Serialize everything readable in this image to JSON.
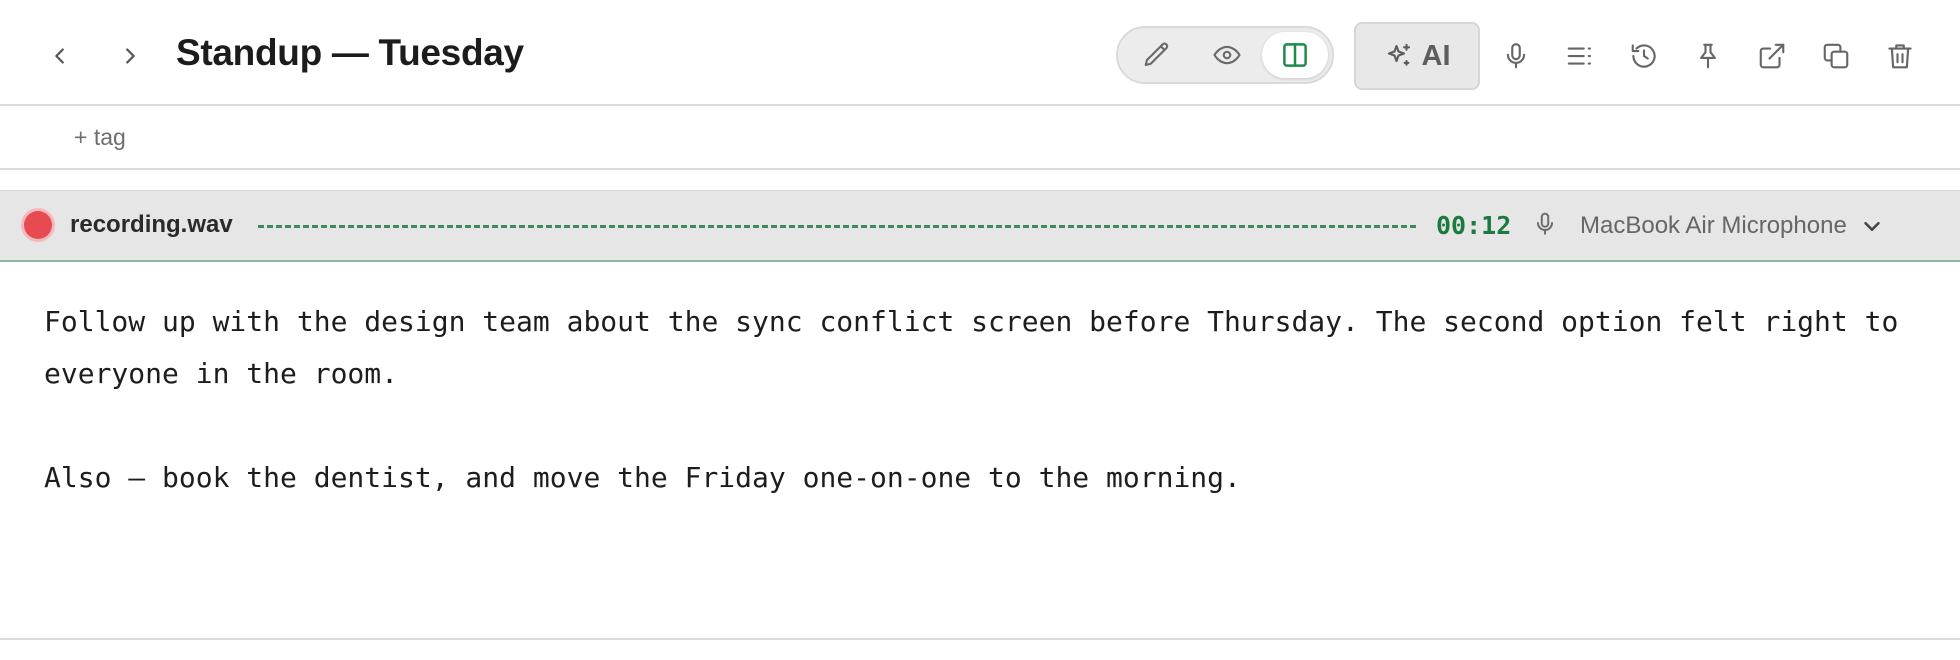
{
  "header": {
    "title": "Standup — Tuesday",
    "view_toggle": {
      "modes": [
        "edit",
        "preview",
        "split"
      ],
      "active": "split"
    },
    "ai_label": "AI",
    "toolbar_icons": [
      "microphone-icon",
      "outline-icon",
      "history-icon",
      "pin-icon",
      "external-link-icon",
      "duplicate-icon",
      "trash-icon"
    ]
  },
  "tags": {
    "add_label": "+ tag"
  },
  "recording": {
    "filename": "recording.wav",
    "elapsed": "00:12",
    "device": "MacBook Air Microphone",
    "state": "recording"
  },
  "editor": {
    "paragraphs": [
      "Follow up with the design team about the sync conflict screen before Thursday. The second option felt right to everyone in the room.",
      "Also — book the dentist, and move the Friday one-on-one to the morning."
    ]
  },
  "colors": {
    "accent_green": "#1b7a3e",
    "record_red": "#e84a51",
    "wave_green": "#3f8a5d"
  }
}
